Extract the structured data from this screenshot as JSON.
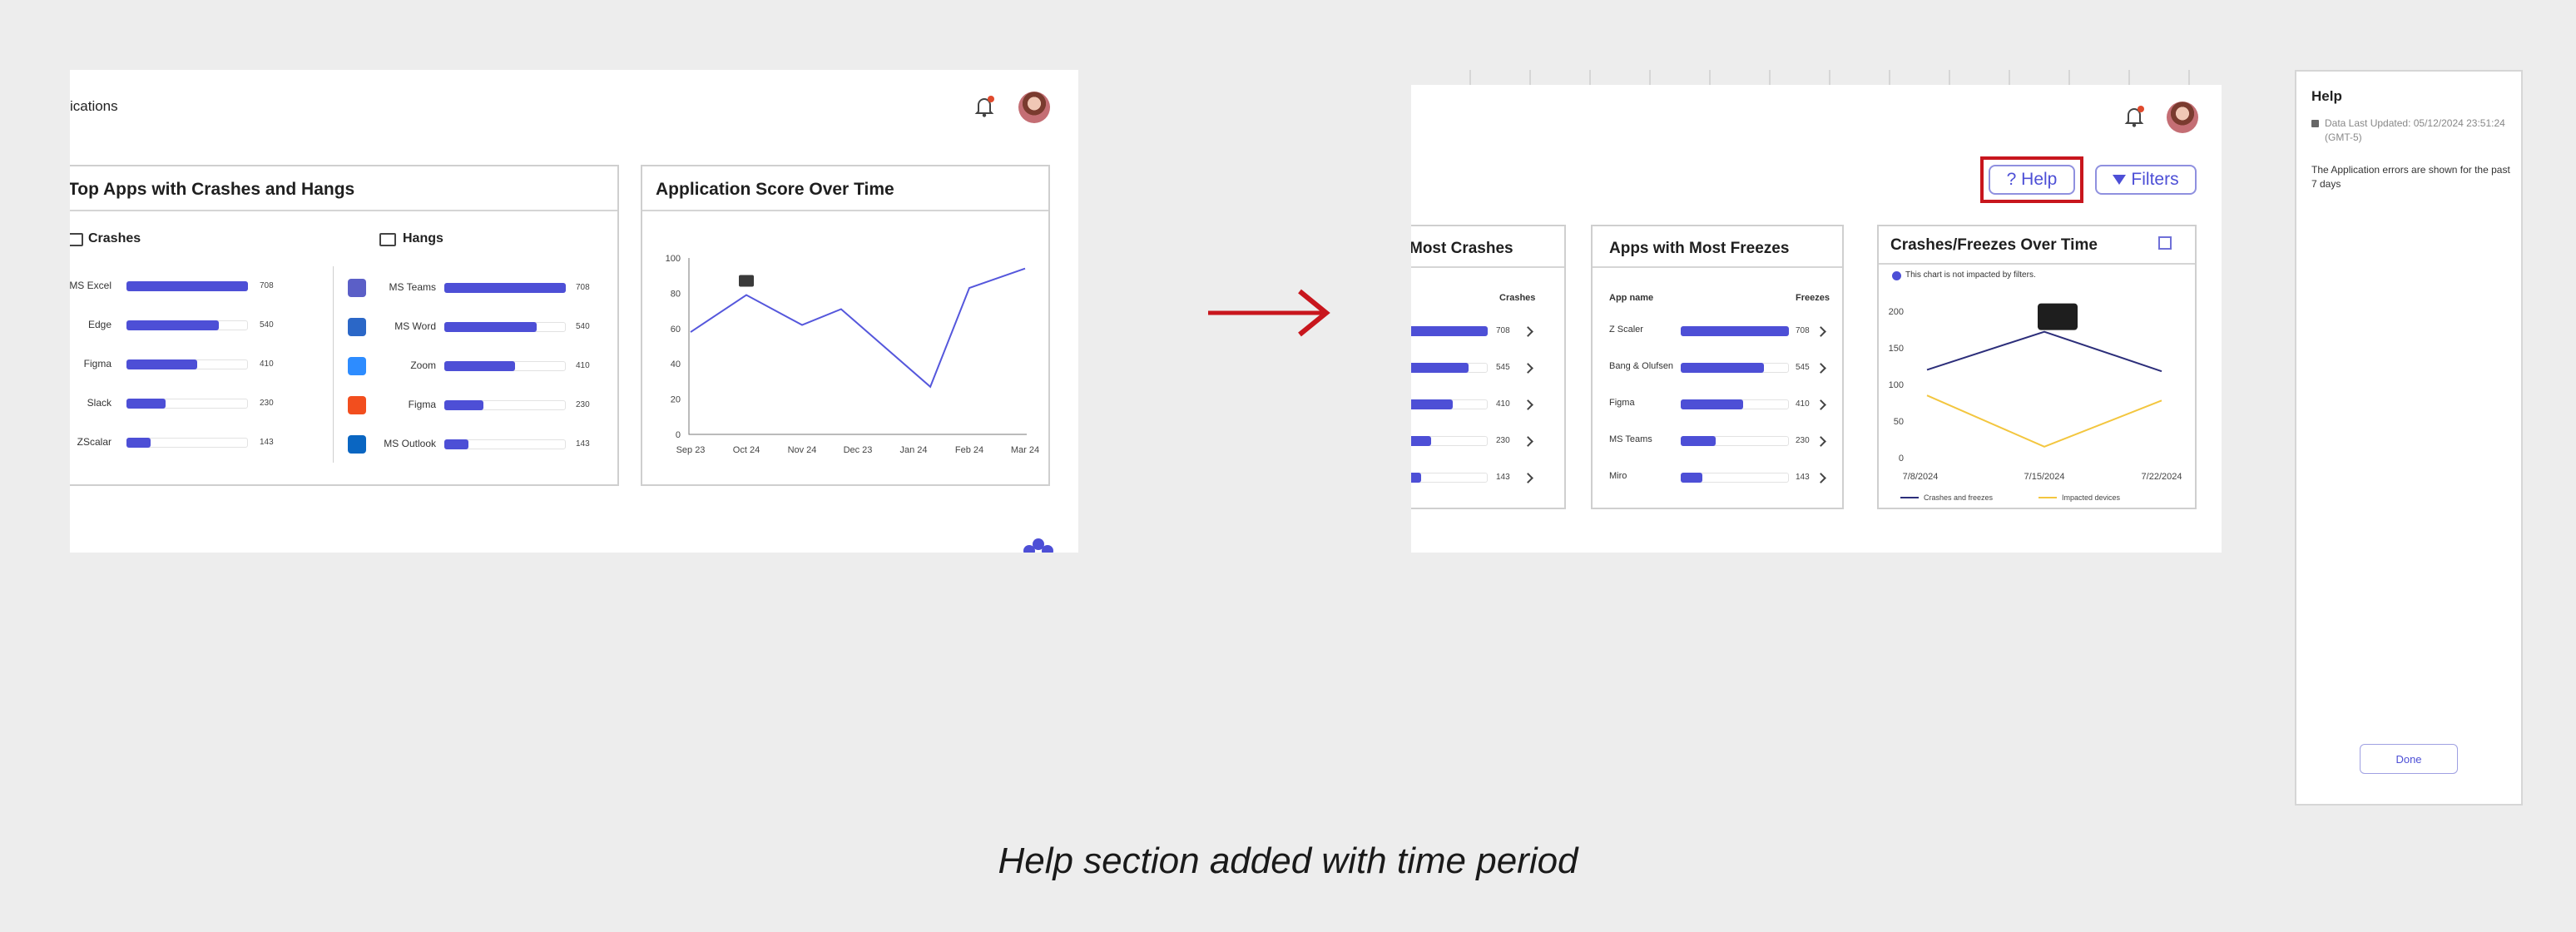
{
  "caption": "Help section added with time period",
  "left": {
    "header_title": "ications",
    "top_apps": {
      "title": "Top Apps with Crashes and Hangs",
      "crashes": {
        "title": "Crashes",
        "items": [
          {
            "label": "MS Excel",
            "value": "708"
          },
          {
            "label": "Edge",
            "value": "540"
          },
          {
            "label": "Figma",
            "value": "410"
          },
          {
            "label": "Slack",
            "value": "230"
          },
          {
            "label": "ZScalar",
            "value": "143"
          }
        ]
      },
      "hangs": {
        "title": "Hangs",
        "items": [
          {
            "label": "MS Teams",
            "value": "708"
          },
          {
            "label": "MS Word",
            "value": "540"
          },
          {
            "label": "Zoom",
            "value": "410"
          },
          {
            "label": "Figma",
            "value": "230"
          },
          {
            "label": "MS Outlook",
            "value": "143"
          }
        ]
      }
    },
    "score": {
      "title": "Application Score Over Time",
      "y_ticks": [
        "100",
        "80",
        "60",
        "40",
        "20",
        "0"
      ],
      "x_ticks": [
        "Sep 23",
        "Oct 24",
        "Nov 24",
        "Dec 23",
        "Jan 24",
        "Feb 24",
        "Mar 24"
      ]
    }
  },
  "right": {
    "help_button": "? Help",
    "filters_button": "Filters",
    "most_crashes": {
      "title": "Most Crashes",
      "col": "Crashes",
      "values": [
        "708",
        "545",
        "410",
        "230",
        "143"
      ]
    },
    "most_freezes": {
      "title": "Apps with Most Freezes",
      "col_app": "App name",
      "col_val": "Freezes",
      "items": [
        {
          "label": "Z Scaler",
          "value": "708"
        },
        {
          "label": "Bang & Olufsen",
          "value": "545"
        },
        {
          "label": "Figma",
          "value": "410"
        },
        {
          "label": "MS Teams",
          "value": "230"
        },
        {
          "label": "Miro",
          "value": "143"
        }
      ]
    },
    "cf_chart": {
      "title": "Crashes/Freezes Over Time",
      "note": "This chart is not impacted by filters.",
      "y_ticks": [
        "200",
        "150",
        "100",
        "50",
        "0"
      ],
      "x_ticks": [
        "7/8/2024",
        "7/15/2024",
        "7/22/2024"
      ],
      "legend": [
        "Crashes and freezes",
        "Impacted devices"
      ]
    }
  },
  "help_panel": {
    "title": "Help",
    "updated": "Data Last Updated: 05/12/2024 23:51:24 (GMT-5)",
    "body": "The Application errors are shown for the past 7 days",
    "done": "Done"
  },
  "colors": {
    "accent": "#4d4fd6",
    "arrow": "#c8161d",
    "yellow": "#f3c63f",
    "notif": "#e0492c"
  },
  "chart_data": [
    {
      "type": "line",
      "title": "Application Score Over Time",
      "categories": [
        "Sep 23",
        "Oct 24",
        "Nov 24",
        "Dec 23",
        "Jan 24",
        "Feb 24",
        "Mar 24"
      ],
      "x_positions": [
        0,
        1,
        2,
        2.7,
        4.3,
        5,
        6
      ],
      "values": [
        58,
        79,
        62,
        71,
        27,
        83,
        94
      ],
      "ylim": [
        0,
        100
      ]
    },
    {
      "type": "bar",
      "title": "Crashes",
      "categories": [
        "MS Excel",
        "Edge",
        "Figma",
        "Slack",
        "ZScalar"
      ],
      "values": [
        708,
        540,
        410,
        230,
        143
      ]
    },
    {
      "type": "bar",
      "title": "Hangs",
      "categories": [
        "MS Teams",
        "MS Word",
        "Zoom",
        "Figma",
        "MS Outlook"
      ],
      "values": [
        708,
        540,
        410,
        230,
        143
      ]
    },
    {
      "type": "bar",
      "title": "Apps with Most Freezes",
      "categories": [
        "Z Scaler",
        "Bang & Olufsen",
        "Figma",
        "MS Teams",
        "Miro"
      ],
      "values": [
        708,
        545,
        410,
        230,
        143
      ]
    },
    {
      "type": "line",
      "title": "Crashes/Freezes Over Time",
      "categories": [
        "7/8/2024",
        "7/15/2024",
        "7/22/2024"
      ],
      "series": [
        {
          "name": "Crashes and freezes",
          "values": [
            120,
            172,
            118
          ]
        },
        {
          "name": "Impacted devices",
          "values": [
            85,
            15,
            78
          ]
        }
      ],
      "ylim": [
        0,
        200
      ]
    }
  ]
}
